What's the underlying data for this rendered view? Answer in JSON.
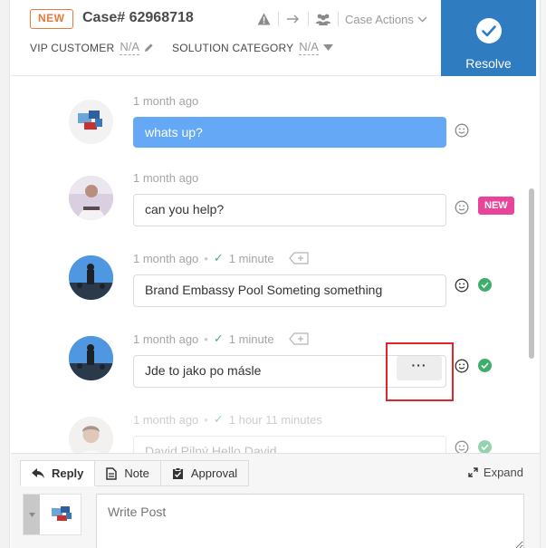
{
  "header": {
    "status_badge": "NEW",
    "case_title": "Case# 62968718",
    "case_actions_label": "Case Actions",
    "fields": [
      {
        "label": "VIP CUSTOMER",
        "value": "N/A"
      },
      {
        "label": "SOLUTION CATEGORY",
        "value": "N/A"
      }
    ],
    "resolve_label": "Resolve"
  },
  "messages": [
    {
      "time": "1 month ago",
      "text": "whats up?",
      "style": "incoming-selected"
    },
    {
      "time": "1 month ago",
      "text": "can you help?",
      "badge": "NEW"
    },
    {
      "time": "1 month ago",
      "response_time": "1 minute",
      "text": "Brand Embassy Pool Someting something",
      "status": "sent"
    },
    {
      "time": "1 month ago",
      "response_time": "1 minute",
      "text": "Jde to jako po másle",
      "status": "sent",
      "more_label": "···"
    },
    {
      "time": "1 month ago",
      "response_time": "1 hour 11 minutes",
      "text": "David Pilný Hello David",
      "status": "sent"
    }
  ],
  "composer": {
    "tabs": [
      {
        "label": "Reply",
        "icon": "reply-icon",
        "active": true
      },
      {
        "label": "Note",
        "icon": "note-icon"
      },
      {
        "label": "Approval",
        "icon": "approval-icon"
      }
    ],
    "expand_label": "Expand",
    "placeholder": "Write Post"
  },
  "colors": {
    "accent": "#2f7cc1",
    "new_badge": "#e8783c",
    "selected_bubble": "#64a8f6",
    "new_pill": "#e8459a",
    "status_green": "#3fae6b",
    "highlight_red": "#e0252d"
  }
}
